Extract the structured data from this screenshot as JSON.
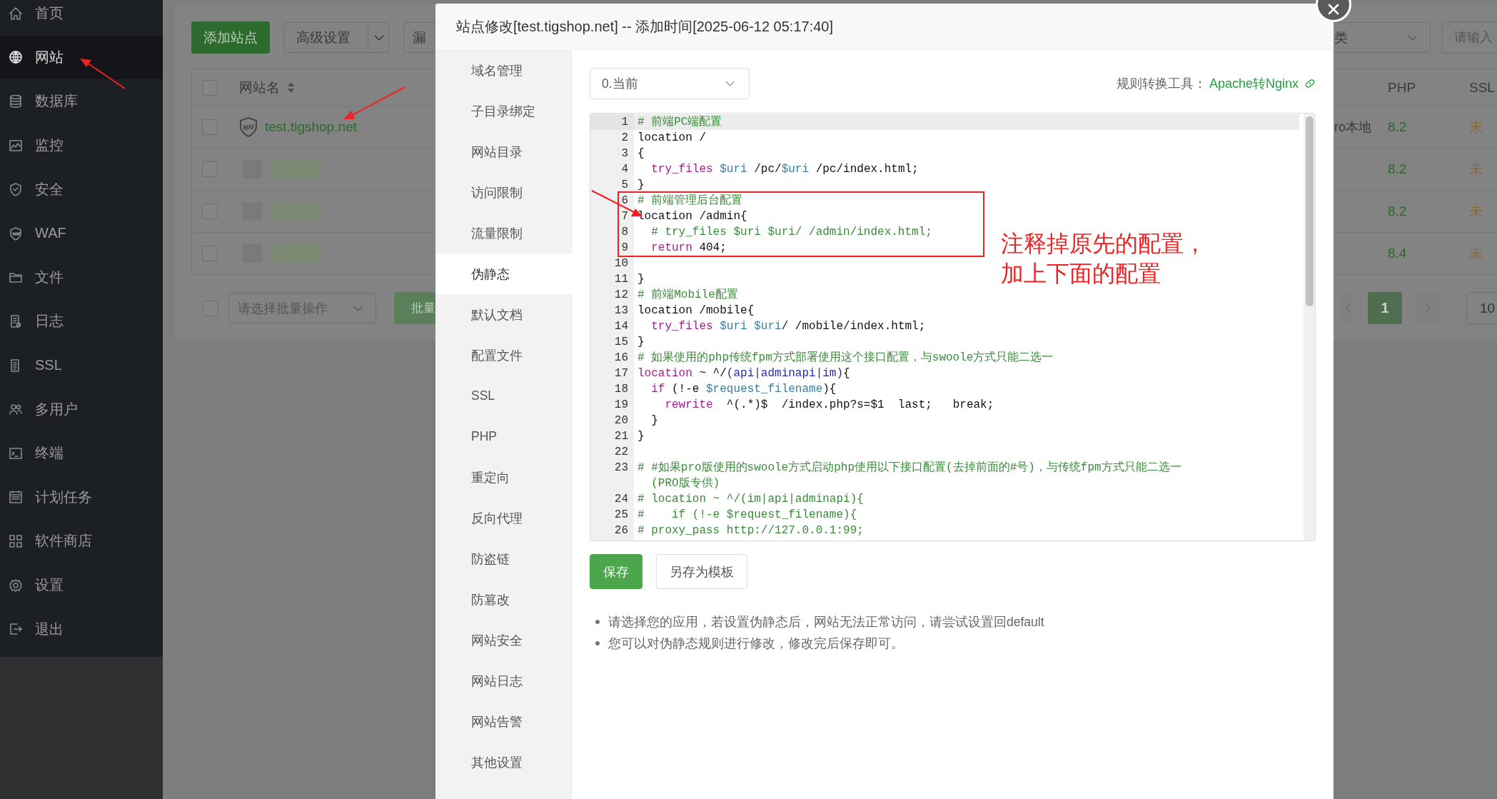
{
  "sidebar": {
    "items": [
      {
        "label": "首页",
        "selected": false
      },
      {
        "label": "网站",
        "selected": true
      },
      {
        "label": "数据库",
        "selected": false
      },
      {
        "label": "监控",
        "selected": false
      },
      {
        "label": "安全",
        "selected": false
      },
      {
        "label": "WAF",
        "selected": false
      },
      {
        "label": "文件",
        "selected": false
      },
      {
        "label": "日志",
        "selected": false
      },
      {
        "label": "SSL",
        "selected": false
      },
      {
        "label": "多用户",
        "selected": false
      },
      {
        "label": "终端",
        "selected": false
      },
      {
        "label": "计划任务",
        "selected": false
      },
      {
        "label": "软件商店",
        "selected": false
      },
      {
        "label": "设置",
        "selected": false
      },
      {
        "label": "退出",
        "selected": false
      }
    ]
  },
  "sites_panel": {
    "add_button": "添加站点",
    "advanced_button": "高级设置",
    "scan_button": "漏",
    "category_select": "类",
    "search": {
      "placeholder": "请输入"
    },
    "table": {
      "select_all_checked": false,
      "columns": {
        "name": "网站名",
        "php": "PHP",
        "ssl": "SSL"
      },
      "rows": [
        {
          "checked": false,
          "redacted": false,
          "name": "test.tigshop.net",
          "remark": "ro本地",
          "php": "8.2",
          "ssl": "未"
        },
        {
          "checked": false,
          "redacted": true,
          "php": "8.2",
          "ssl": "未"
        },
        {
          "checked": false,
          "redacted": true,
          "php": "8.2",
          "ssl": "未"
        },
        {
          "checked": false,
          "redacted": true,
          "php": "8.4",
          "ssl": "未"
        }
      ]
    },
    "batch_select": {
      "checked": false,
      "placeholder": "请选择批量操作"
    },
    "batch_button": "批量",
    "pagination": {
      "pages": [
        {
          "label": "1",
          "selected": true
        }
      ],
      "page_size": "10"
    }
  },
  "modal": {
    "title": "站点修改[test.tigshop.net] -- 添加时间[2025-06-12 05:17:40]",
    "nav": [
      {
        "label": "域名管理",
        "selected": false
      },
      {
        "label": "子目录绑定",
        "selected": false
      },
      {
        "label": "网站目录",
        "selected": false
      },
      {
        "label": "访问限制",
        "selected": false
      },
      {
        "label": "流量限制",
        "selected": false
      },
      {
        "label": "伪静态",
        "selected": true
      },
      {
        "label": "默认文档",
        "selected": false
      },
      {
        "label": "配置文件",
        "selected": false
      },
      {
        "label": "SSL",
        "selected": false
      },
      {
        "label": "PHP",
        "selected": false
      },
      {
        "label": "重定向",
        "selected": false
      },
      {
        "label": "反向代理",
        "selected": false
      },
      {
        "label": "防盗链",
        "selected": false
      },
      {
        "label": "防篡改",
        "selected": false
      },
      {
        "label": "网站安全",
        "selected": false
      },
      {
        "label": "网站日志",
        "selected": false
      },
      {
        "label": "网站告警",
        "selected": false
      },
      {
        "label": "其他设置",
        "selected": false
      }
    ],
    "version_select": "0.当前",
    "converter": {
      "label": "规则转换工具：",
      "link": "Apache转Nginx"
    },
    "editor": {
      "lines": [
        {
          "number": "1",
          "active": true,
          "tokens": [
            {
              "kind": "comment",
              "text": "# 前端PC端配置"
            }
          ]
        },
        {
          "number": "2",
          "active": false,
          "tokens": [
            {
              "kind": "plain",
              "text": "location /"
            }
          ]
        },
        {
          "number": "3",
          "active": false,
          "tokens": [
            {
              "kind": "plain",
              "text": "{"
            }
          ]
        },
        {
          "number": "4",
          "active": false,
          "tokens": [
            {
              "kind": "keyword",
              "text": "  try_files"
            },
            {
              "kind": "variable",
              "text": " $uri"
            },
            {
              "kind": "plain",
              "text": " /pc/"
            },
            {
              "kind": "variable",
              "text": "$uri"
            },
            {
              "kind": "plain",
              "text": " /pc/index.html;"
            }
          ]
        },
        {
          "number": "5",
          "active": false,
          "tokens": [
            {
              "kind": "plain",
              "text": "}"
            }
          ]
        },
        {
          "number": "6",
          "active": false,
          "tokens": [
            {
              "kind": "comment",
              "text": "# 前端管理后台配置"
            }
          ]
        },
        {
          "number": "7",
          "active": false,
          "tokens": [
            {
              "kind": "plain",
              "text": "location /admin{"
            }
          ]
        },
        {
          "number": "8",
          "active": false,
          "tokens": [
            {
              "kind": "comment",
              "text": "  # try_files $uri $uri/ /admin/index.html;"
            }
          ]
        },
        {
          "number": "9",
          "active": false,
          "tokens": [
            {
              "kind": "keyword",
              "text": "  return"
            },
            {
              "kind": "plain",
              "text": " 404;"
            }
          ]
        },
        {
          "number": "10",
          "active": false
        },
        {
          "number": "11",
          "active": false,
          "tokens": [
            {
              "kind": "plain",
              "text": "}"
            }
          ]
        },
        {
          "number": "12",
          "active": false,
          "tokens": [
            {
              "kind": "comment",
              "text": "# 前端Mobile配置"
            }
          ]
        },
        {
          "number": "13",
          "active": false,
          "tokens": [
            {
              "kind": "plain",
              "text": "location /mobile{"
            }
          ]
        },
        {
          "number": "14",
          "active": false,
          "tokens": [
            {
              "kind": "keyword",
              "text": "  try_files"
            },
            {
              "kind": "variable",
              "text": " $uri"
            },
            {
              "kind": "variable",
              "text": " $uri"
            },
            {
              "kind": "plain",
              "text": "/ /mobile/index.html;"
            }
          ]
        },
        {
          "number": "15",
          "active": false,
          "tokens": [
            {
              "kind": "plain",
              "text": "}"
            }
          ]
        },
        {
          "number": "16",
          "active": false,
          "tokens": [
            {
              "kind": "comment",
              "text": "# 如果使用的php传统fpm方式部署使用这个接口配置，与swoole方式只能二选一"
            }
          ]
        },
        {
          "number": "17",
          "active": false,
          "tokens": [
            {
              "kind": "keyword",
              "text": "location"
            },
            {
              "kind": "plain",
              "text": " ~ ^/"
            },
            {
              "kind": "regex",
              "text": "(api|adminapi|im)"
            },
            {
              "kind": "plain",
              "text": "{"
            }
          ]
        },
        {
          "number": "18",
          "active": false,
          "tokens": [
            {
              "kind": "keyword",
              "text": "  if"
            },
            {
              "kind": "plain",
              "text": " (!-e "
            },
            {
              "kind": "variable",
              "text": "$request_filename"
            },
            {
              "kind": "plain",
              "text": "){"
            }
          ]
        },
        {
          "number": "19",
          "active": false,
          "tokens": [
            {
              "kind": "keyword",
              "text": "    rewrite"
            },
            {
              "kind": "plain",
              "text": "  ^(.*)$  /index.php?s=$1  last;   break;"
            }
          ]
        },
        {
          "number": "20",
          "active": false,
          "tokens": [
            {
              "kind": "plain",
              "text": "  }"
            }
          ]
        },
        {
          "number": "21",
          "active": false,
          "tokens": [
            {
              "kind": "plain",
              "text": "}"
            }
          ]
        },
        {
          "number": "22",
          "active": false
        },
        {
          "number": "23",
          "active": false,
          "tokens": [
            {
              "kind": "comment",
              "text": "# #如果pro版使用的swoole方式启动php使用以下接口配置(去掉前面的#号)，与传统fpm方式只能二选一(PRO版专供)"
            }
          ]
        },
        {
          "number": "24",
          "active": false,
          "tokens": [
            {
              "kind": "comment",
              "text": "# location ~ ^/(im|api|adminapi){"
            }
          ]
        },
        {
          "number": "25",
          "active": false,
          "tokens": [
            {
              "kind": "comment",
              "text": "#    if (!-e $request_filename){"
            }
          ]
        },
        {
          "number": "26",
          "active": false,
          "tokens": [
            {
              "kind": "comment",
              "text": "# proxy_pass http://127.0.0.1:99;"
            }
          ]
        }
      ]
    },
    "buttons": [
      {
        "label": "保存",
        "kind": "primary"
      },
      {
        "label": "另存为模板",
        "kind": "default"
      }
    ],
    "notes": [
      "请选择您的应用，若设置伪静态后，网站无法正常访问，请尝试设置回default",
      "您可以对伪静态规则进行修改，修改完后保存即可。"
    ]
  },
  "annotation": {
    "note": [
      "注释掉原先的配置，",
      "加上下面的配置"
    ]
  }
}
